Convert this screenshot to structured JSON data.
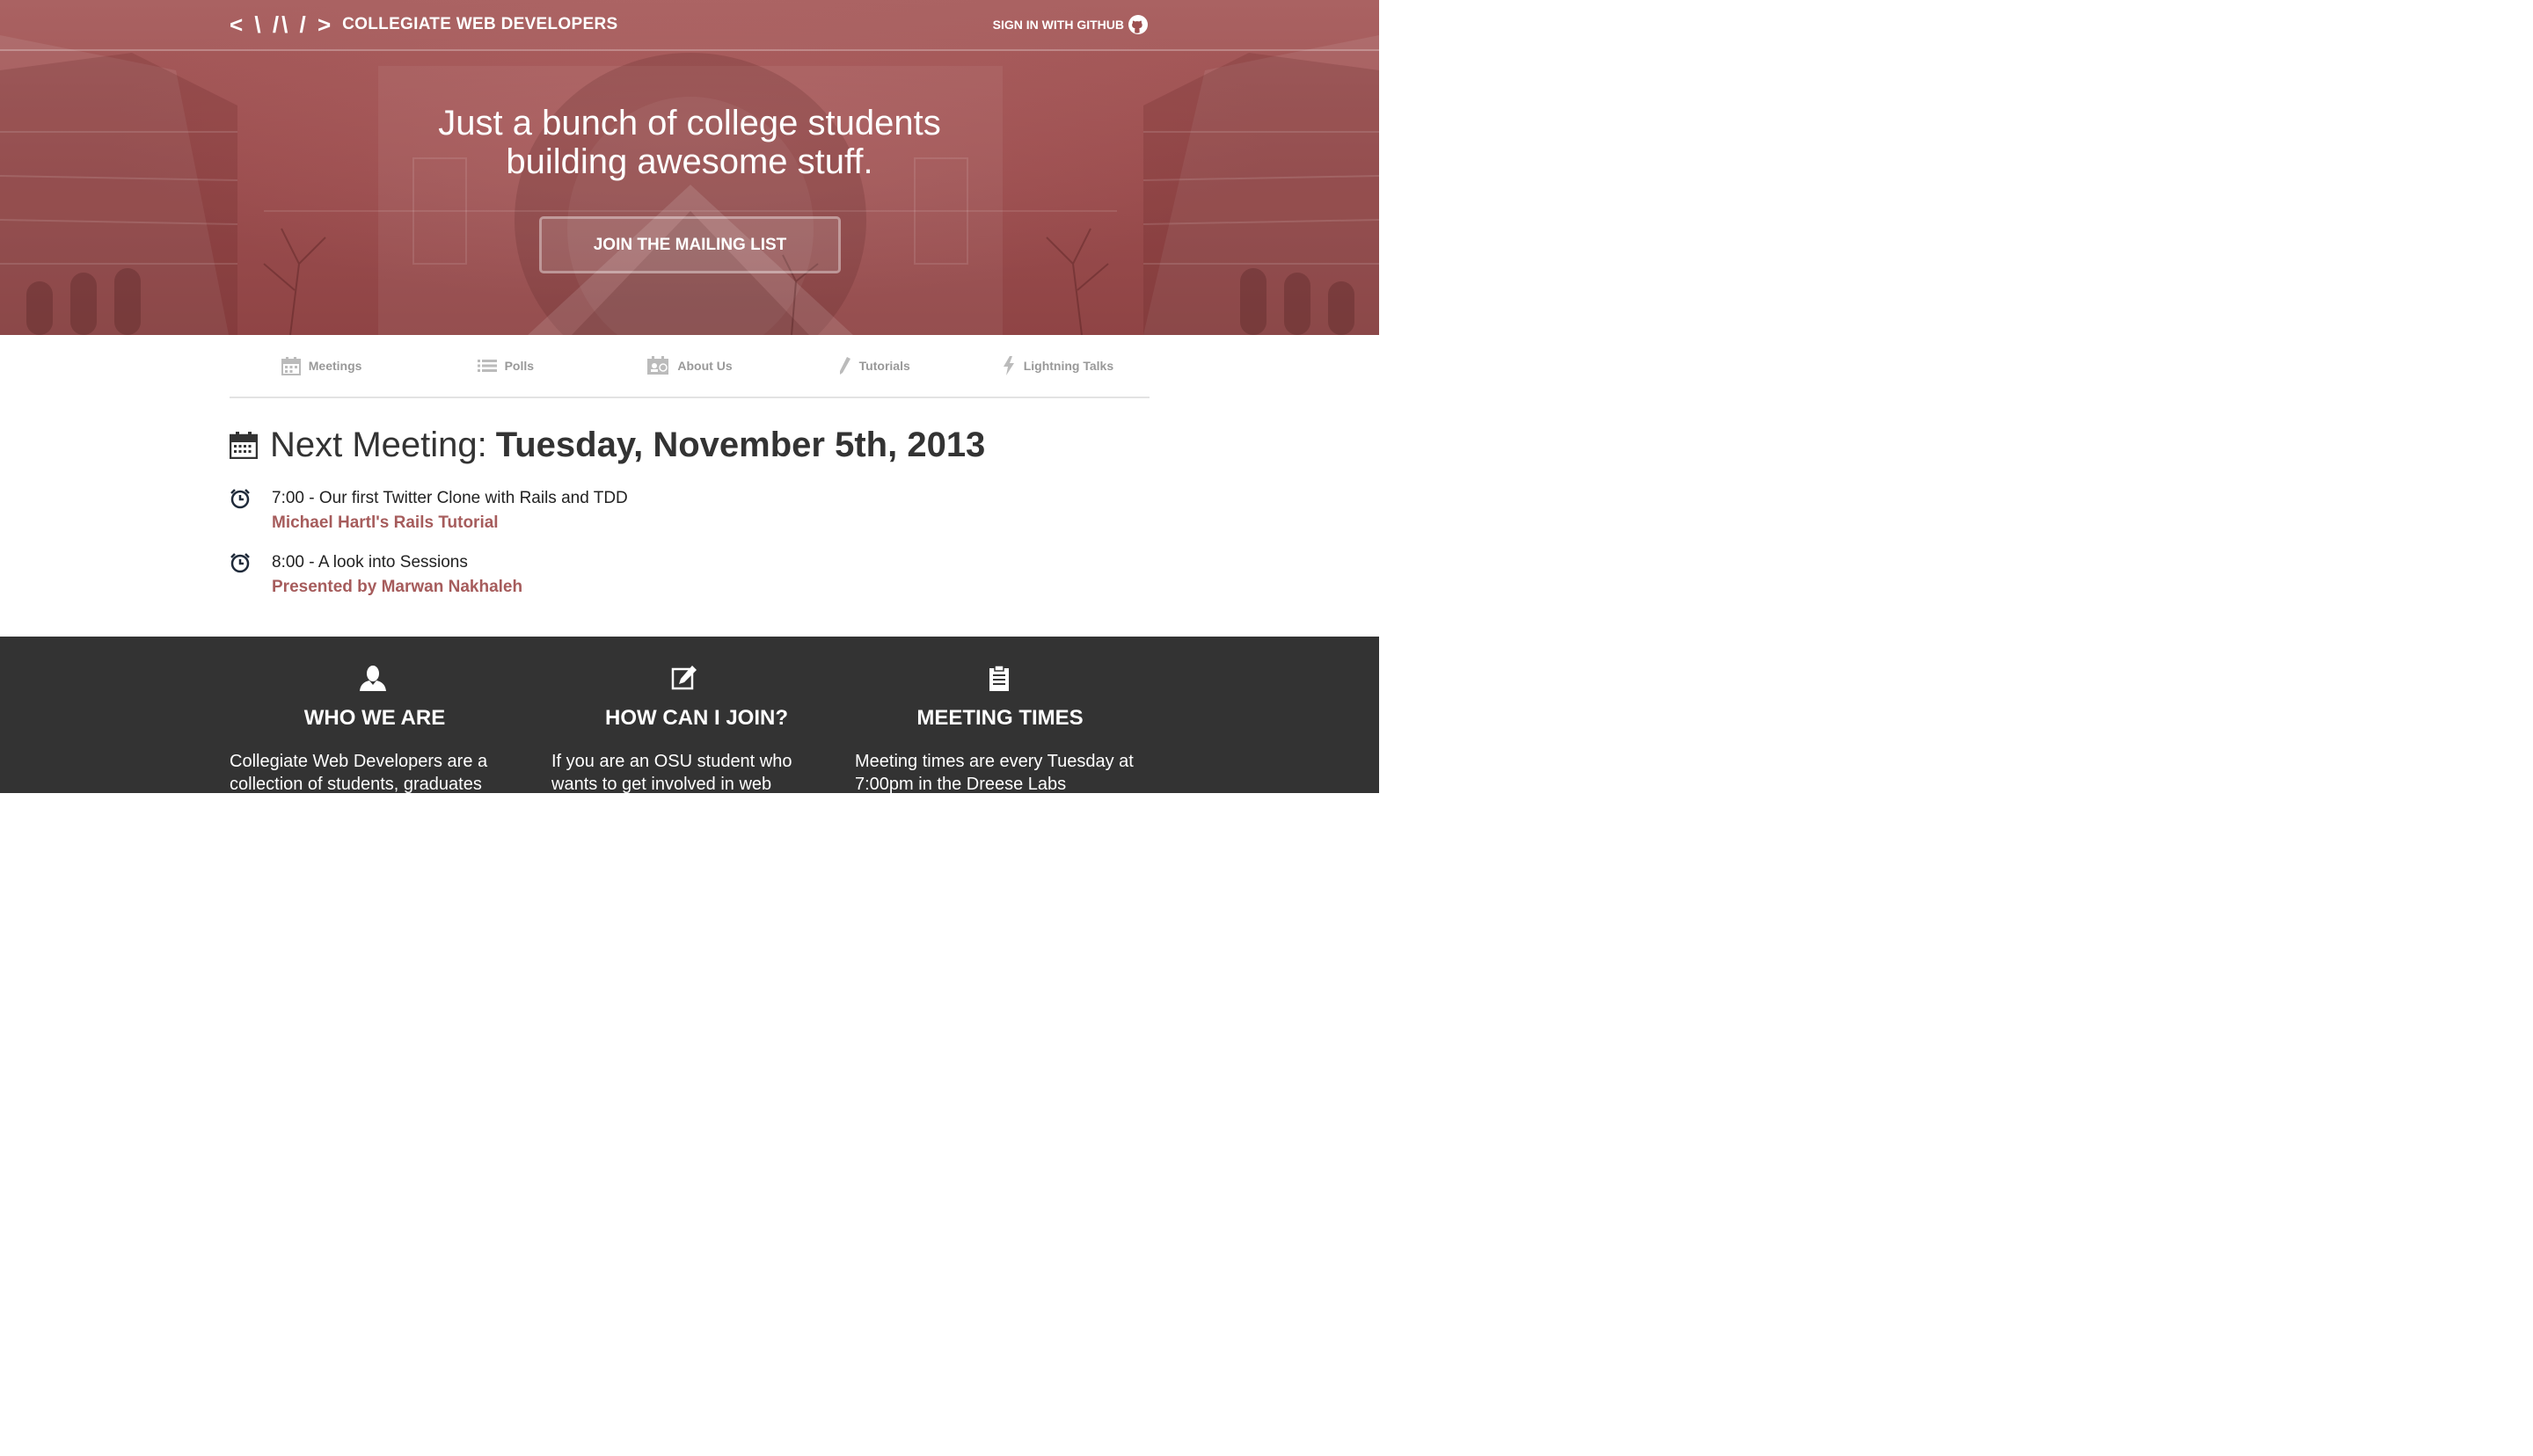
{
  "brand": {
    "mark": "< \\ /\\ / >",
    "name": "COLLEGIATE WEB DEVELOPERS"
  },
  "header": {
    "signin_label": "SIGN IN WITH GITHUB"
  },
  "hero": {
    "headline_line1": "Just a bunch of college students",
    "headline_line2": "building awesome stuff.",
    "cta_label": "JOIN THE MAILING LIST"
  },
  "nav": {
    "items": [
      {
        "label": "Meetings",
        "icon": "calendar-icon"
      },
      {
        "label": "Polls",
        "icon": "list-icon"
      },
      {
        "label": "About Us",
        "icon": "id-card-icon"
      },
      {
        "label": "Tutorials",
        "icon": "pencil-icon"
      },
      {
        "label": "Lightning Talks",
        "icon": "lightning-icon"
      }
    ]
  },
  "next_meeting": {
    "label": "Next Meeting:",
    "date": "Tuesday, November 5th, 2013",
    "agenda": [
      {
        "title": "7:00 - Our first Twitter Clone with Rails and TDD",
        "subtitle": "Michael Hartl's Rails Tutorial"
      },
      {
        "title": "8:00 - A look into Sessions",
        "subtitle": "Presented by Marwan Nakhaleh"
      }
    ]
  },
  "info": {
    "columns": [
      {
        "icon": "person-icon",
        "heading": "WHO WE ARE",
        "text": "Collegiate Web Developers are a collection of students, graduates"
      },
      {
        "icon": "edit-icon",
        "heading": "HOW CAN I JOIN?",
        "text": "If you are an OSU student who wants to get involved in web"
      },
      {
        "icon": "clipboard-icon",
        "heading": "MEETING TIMES",
        "text": "Meeting times are every Tuesday at 7:00pm in the Dreese Labs"
      }
    ]
  },
  "colors": {
    "hero_red": "#9d4f50",
    "accent": "#a65c5c",
    "footer_bg": "#333333",
    "nav_text": "#999999"
  }
}
